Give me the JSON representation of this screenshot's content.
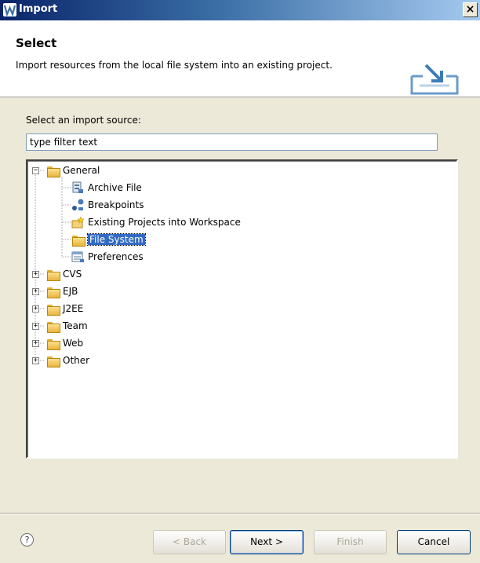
{
  "window": {
    "title": "Import",
    "close_glyph": "×"
  },
  "header": {
    "title": "Select",
    "description": "Import resources from the local file system into an existing project."
  },
  "source": {
    "label": "Select an import source:",
    "filter_value": "type filter text"
  },
  "tree": {
    "nodes": [
      {
        "label": "General",
        "icon": "folder-icon",
        "expanded": true
      },
      {
        "label": "Archive File",
        "icon": "archive-file-icon"
      },
      {
        "label": "Breakpoints",
        "icon": "breakpoints-icon"
      },
      {
        "label": "Existing Projects into Workspace",
        "icon": "project-icon"
      },
      {
        "label": "File System",
        "icon": "folder-icon",
        "selected": true
      },
      {
        "label": "Preferences",
        "icon": "preferences-icon"
      },
      {
        "label": "CVS",
        "icon": "folder-icon",
        "expanded": false
      },
      {
        "label": "EJB",
        "icon": "folder-icon",
        "expanded": false
      },
      {
        "label": "J2EE",
        "icon": "folder-icon",
        "expanded": false
      },
      {
        "label": "Team",
        "icon": "folder-icon",
        "expanded": false
      },
      {
        "label": "Web",
        "icon": "folder-icon",
        "expanded": false
      },
      {
        "label": "Other",
        "icon": "folder-icon",
        "expanded": false
      }
    ]
  },
  "footer": {
    "help_glyph": "?",
    "back_label": "< Back",
    "next_label": "Next >",
    "finish_label": "Finish",
    "cancel_label": "Cancel"
  },
  "colors": {
    "selection": "#316ac5",
    "titlebar": "#0a246a",
    "dialog_bg": "#ece9d8"
  }
}
